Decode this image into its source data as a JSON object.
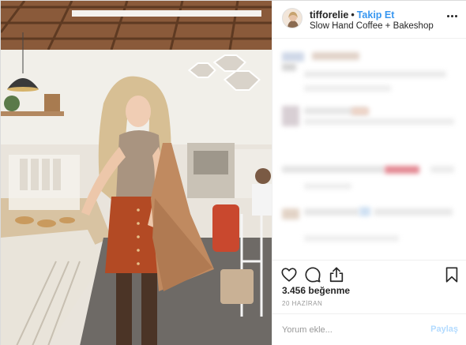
{
  "post": {
    "username": "tifforelie",
    "separator": "•",
    "follow_label": "Takip Et",
    "location": "Slow Hand Coffee + Bakeshop",
    "more_icon": "more-options-icon"
  },
  "actions": {
    "like_icon": "heart-icon",
    "comment_icon": "comment-icon",
    "share_icon": "share-icon",
    "save_icon": "bookmark-icon"
  },
  "likes_text": "3.456 beğenme",
  "date_text": "20 HAZİRAN",
  "comment_box": {
    "placeholder": "Yorum ekle...",
    "post_label": "Paylaş"
  },
  "colors": {
    "follow": "#3897f0",
    "post_disabled": "#b3dbff",
    "border": "#efefef",
    "muted": "#999999"
  }
}
